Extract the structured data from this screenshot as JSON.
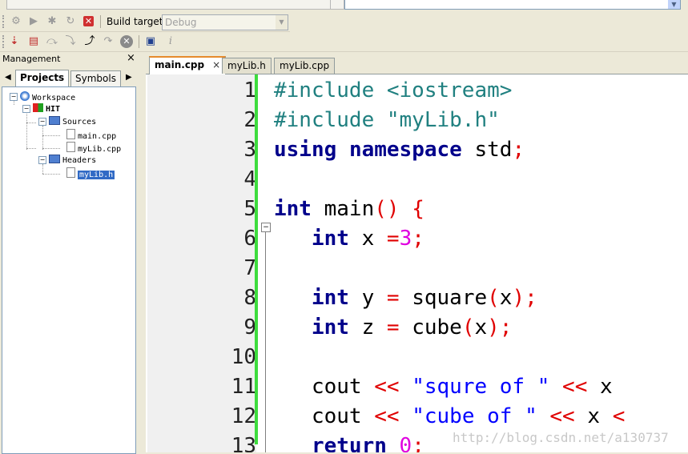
{
  "toolbar": {
    "build_target_label": "Build target:",
    "build_target_value": "Debug"
  },
  "management": {
    "title": "Management",
    "close_icon": "×",
    "tabs": [
      {
        "label": "Projects",
        "active": true
      },
      {
        "label": "Symbols",
        "active": false
      }
    ],
    "tree": {
      "workspace": "Workspace",
      "project": "HIT",
      "sources_folder": "Sources",
      "sources": [
        "main.cpp",
        "myLib.cpp"
      ],
      "headers_folder": "Headers",
      "headers": [
        "myLib.h"
      ],
      "selected": "myLib.h"
    }
  },
  "editor": {
    "tabs": [
      {
        "label": "main.cpp",
        "active": true,
        "close": "×"
      },
      {
        "label": "myLib.h",
        "active": false
      },
      {
        "label": "myLib.cpp",
        "active": false
      }
    ],
    "line_numbers": [
      "1",
      "2",
      "3",
      "4",
      "5",
      "6",
      "7",
      "8",
      "9",
      "10",
      "11",
      "12",
      "13"
    ]
  },
  "watermark": "http://blog.csdn.net/a130737",
  "colors": {
    "keyword": "#00008b",
    "preprocessor": "#208080",
    "operator": "#e00000",
    "number": "#e000e0",
    "string": "#0000ff",
    "change_bar": "#3ddc3d",
    "active_tab_accent": "#e68b2c",
    "selection": "#316ac5"
  }
}
